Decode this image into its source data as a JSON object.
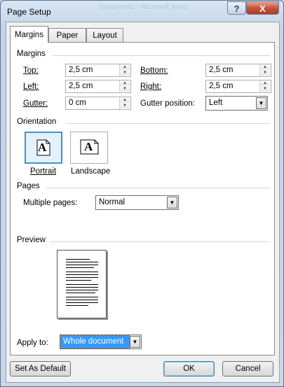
{
  "window": {
    "title": "Page Setup",
    "background_title": "Document1 - Microsoft Word",
    "help_label": "?",
    "close_label": "X"
  },
  "tabs": [
    {
      "label": "Margins",
      "active": true
    },
    {
      "label": "Paper",
      "active": false
    },
    {
      "label": "Layout",
      "active": false
    }
  ],
  "margins": {
    "section_label": "Margins",
    "top": {
      "label": "Top:",
      "value": "2,5 cm"
    },
    "bottom": {
      "label": "Bottom:",
      "value": "2,5 cm"
    },
    "left": {
      "label": "Left:",
      "value": "2,5 cm"
    },
    "right": {
      "label": "Right:",
      "value": "2,5 cm"
    },
    "gutter": {
      "label": "Gutter:",
      "value": "0 cm"
    },
    "gutter_position": {
      "label": "Gutter position:",
      "value": "Left"
    }
  },
  "orientation": {
    "section_label": "Orientation",
    "portrait": {
      "label": "Portrait",
      "letter": "A",
      "selected": true
    },
    "landscape": {
      "label": "Landscape",
      "letter": "A",
      "selected": false
    }
  },
  "pages": {
    "section_label": "Pages",
    "multiple_pages_label": "Multiple pages:",
    "multiple_pages_value": "Normal"
  },
  "preview": {
    "section_label": "Preview"
  },
  "apply_to": {
    "label": "Apply to:",
    "value": "Whole document"
  },
  "buttons": {
    "set_default": "Set As Default",
    "ok": "OK",
    "cancel": "Cancel"
  },
  "colors": {
    "selection": "#3399ff",
    "focus_border": "#3d94cc",
    "close_button": "#c7533a"
  }
}
